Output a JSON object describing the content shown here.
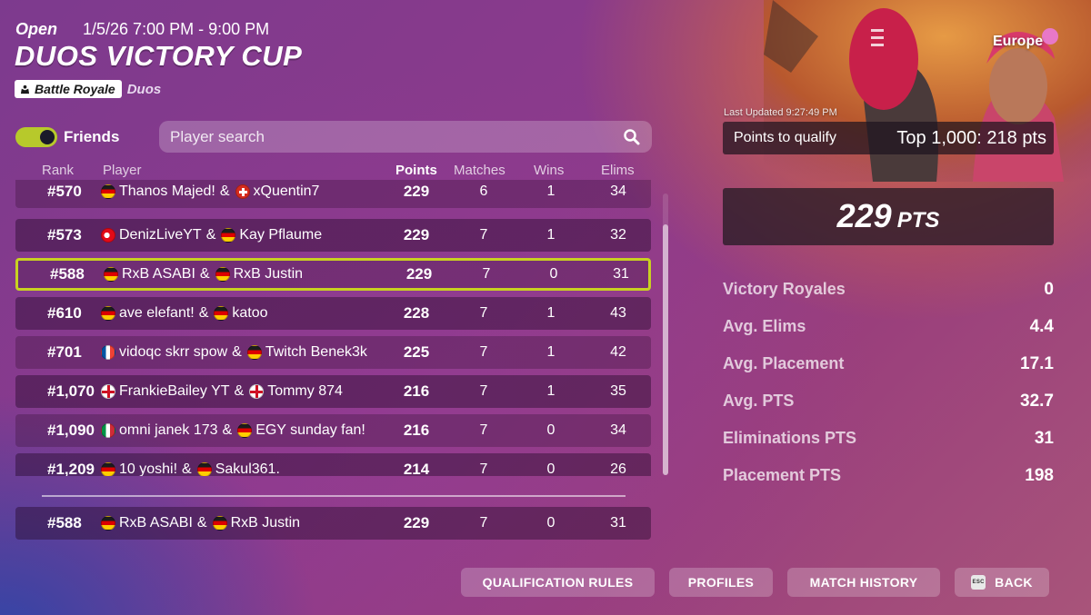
{
  "event": {
    "status": "Open",
    "datetime": "1/5/26 7:00 PM - 9:00 PM",
    "title": "DUOS VICTORY CUP",
    "mode": "Battle Royale",
    "team_size": "Duos"
  },
  "filters": {
    "friends_label": "Friends",
    "friends_toggle_on": true,
    "search_placeholder": "Player search"
  },
  "table": {
    "headers": {
      "rank": "Rank",
      "player": "Player",
      "points": "Points",
      "matches": "Matches",
      "wins": "Wins",
      "elims": "Elims"
    },
    "rows": [
      {
        "rank": "#570",
        "p1_flag": "de",
        "p1": "Thanos Majed!",
        "amp": "&",
        "p2_flag": "ch",
        "p2": "xQuentin7",
        "points": "229",
        "matches": "6",
        "wins": "1",
        "elims": "34"
      },
      {
        "rank": "#573",
        "p1_flag": "tr",
        "p1": "DenizLiveYT",
        "amp": "&",
        "p2_flag": "de",
        "p2": "Kay Pflaume",
        "points": "229",
        "matches": "7",
        "wins": "1",
        "elims": "32"
      },
      {
        "rank": "#588",
        "p1_flag": "de",
        "p1": "RxB ASABI",
        "amp": "&",
        "p2_flag": "de",
        "p2": "RxB Justin",
        "points": "229",
        "matches": "7",
        "wins": "0",
        "elims": "31"
      },
      {
        "rank": "#610",
        "p1_flag": "de",
        "p1": "ave elefant!",
        "amp": "&",
        "p2_flag": "de",
        "p2": "katoo",
        "points": "228",
        "matches": "7",
        "wins": "1",
        "elims": "43"
      },
      {
        "rank": "#701",
        "p1_flag": "fr",
        "p1": "vidoqc skrr spow",
        "amp": "&",
        "p2_flag": "de",
        "p2": "Twitch Benek3k",
        "points": "225",
        "matches": "7",
        "wins": "1",
        "elims": "42"
      },
      {
        "rank": "#1,070",
        "p1_flag": "en",
        "p1": "FrankieBailey YT",
        "amp": "&",
        "p2_flag": "en",
        "p2": "Tommy 874",
        "points": "216",
        "matches": "7",
        "wins": "1",
        "elims": "35"
      },
      {
        "rank": "#1,090",
        "p1_flag": "it",
        "p1": "omni janek 173",
        "amp": "&",
        "p2_flag": "de",
        "p2": "EGY sunday fan!",
        "points": "216",
        "matches": "7",
        "wins": "0",
        "elims": "34"
      },
      {
        "rank": "#1,209",
        "p1_flag": "de",
        "p1": "10 yoshi!",
        "amp": "&",
        "p2_flag": "de",
        "p2": "Sakul361.",
        "points": "214",
        "matches": "7",
        "wins": "0",
        "elims": "26"
      }
    ],
    "pinned": {
      "rank": "#588",
      "p1_flag": "de",
      "p1": "RxB ASABI",
      "amp": "&",
      "p2_flag": "de",
      "p2": "RxB Justin",
      "points": "229",
      "matches": "7",
      "wins": "0",
      "elims": "31"
    }
  },
  "summary": {
    "region": "Europe",
    "last_updated": "Last Updated 9:27:49 PM",
    "qualify_label": "Points to qualify",
    "qualify_value": "Top 1,000: 218 pts",
    "total_points": "229",
    "total_unit": "PTS",
    "stats": [
      {
        "label": "Victory Royales",
        "value": "0"
      },
      {
        "label": "Avg. Elims",
        "value": "4.4"
      },
      {
        "label": "Avg. Placement",
        "value": "17.1"
      },
      {
        "label": "Avg. PTS",
        "value": "32.7"
      },
      {
        "label": "Eliminations PTS",
        "value": "31"
      },
      {
        "label": "Placement PTS",
        "value": "198"
      }
    ]
  },
  "buttons": {
    "qualification_rules": "QUALIFICATION RULES",
    "profiles": "PROFILES",
    "match_history": "MATCH HISTORY",
    "back": "BACK",
    "esc_key": "ESC"
  },
  "colors": {
    "highlight": "#c8d121",
    "toggle_on": "#b7c92b"
  }
}
